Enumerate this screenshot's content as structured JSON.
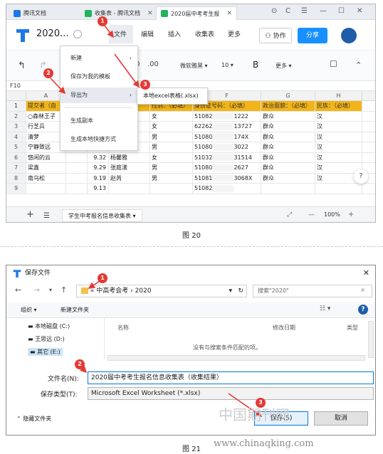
{
  "fig1": {
    "tabs": [
      {
        "label": "腾讯文档",
        "color": "#1d78e6"
      },
      {
        "label": "收集表 - 腾讯文档",
        "color": "#22b35e"
      },
      {
        "label": "2020届中考考生报",
        "color": "#22b35e"
      }
    ],
    "window_controls": [
      "⊙",
      "C",
      "☰",
      "—",
      "☐",
      "✕"
    ],
    "doc_title": "2020...",
    "menus": [
      "文件",
      "编辑",
      "插入",
      "收集表",
      "更多"
    ],
    "collab_label": "协作",
    "share_label": "分享",
    "toolbar": {
      "undo": "↰",
      "redo": "↱",
      "decimal_hint": ".0",
      "decimal_hint2": ".00",
      "font": "微软雅黑 ▾",
      "font_size": "10 ▾",
      "bold": "B",
      "more": "更多 ▾",
      "comment": "☐",
      "collapse": "⌃"
    },
    "cell_ref": "F10",
    "columns": [
      "",
      "A",
      "B",
      "C",
      "D",
      "E",
      "F",
      "G",
      "H"
    ],
    "header_row": [
      "提交者（自",
      "",
      "",
      "",
      "性别：（必填）",
      "身份证号码：（必填）",
      "政治面貌：（必填）",
      "民族：（必填）"
    ],
    "rows": [
      {
        "num": "2",
        "a": "○森林王子",
        "c": "",
        "d": "",
        "e": "女",
        "f": "51082",
        "f2": "1222",
        "g": "群众",
        "h": "汉"
      },
      {
        "num": "3",
        "a": "行芝兵",
        "c": "",
        "d": "",
        "e": "女",
        "f": "62262",
        "f2": "13727",
        "g": "群众",
        "h": "汉"
      },
      {
        "num": "4",
        "a": "清梦",
        "c": "",
        "d": "",
        "e": "男",
        "f": "51080",
        "f2": "174X",
        "g": "群众",
        "h": "汉"
      },
      {
        "num": "5",
        "a": "宁静致远",
        "c": "",
        "d": "",
        "e": "男",
        "f": "51080",
        "f2": "3022",
        "g": "群众",
        "h": "汉"
      },
      {
        "num": "6",
        "a": "悠闲的云",
        "c": "9.32",
        "d": "杨馨雅",
        "e": "女",
        "f": "51032",
        "f2": "31514",
        "g": "群众",
        "h": "汉"
      },
      {
        "num": "7",
        "a": "梁鑫",
        "c": "9.29",
        "d": "张庭漾",
        "e": "男",
        "f": "51080",
        "f2": "2627",
        "g": "群众",
        "h": "汉"
      },
      {
        "num": "8",
        "a": "南乌松",
        "c": "9.19",
        "d": "赵芮",
        "e": "男",
        "f": "51081",
        "f2": "3068X",
        "g": "群众",
        "h": "汉"
      },
      {
        "num": "9",
        "a": "",
        "c": "9.13",
        "d": "",
        "e": "",
        "f": "51082",
        "f2": "",
        "g": "",
        "h": ""
      }
    ],
    "sheet_tab": "学生中考报名信息收集表 ▾",
    "add_sheet": "+",
    "zoom": "100%",
    "zoom_minus": "—",
    "zoom_plus": "+",
    "help": "?",
    "dropdown": [
      {
        "label": "新建",
        "arrow": "›"
      },
      {
        "label": "保存为我的模板",
        "arrow": ""
      },
      {
        "label": "导出为",
        "arrow": "›"
      },
      {
        "label": "生成副本",
        "arrow": ""
      },
      {
        "label": "生成本地快捷方式",
        "arrow": ""
      }
    ],
    "submenu_item": "本地excel表格(.xlsx)",
    "badges": [
      "1",
      "2",
      "3"
    ]
  },
  "caption1": "图 20",
  "fig2": {
    "title": "保存文件",
    "close": "✕",
    "address_parts": [
      "«",
      "中高考会考",
      "›",
      "2020"
    ],
    "search_placeholder": "搜索\"2020\"",
    "organize": "组织 ▾",
    "new_folder": "新建文件夹",
    "drives": [
      {
        "label": "本地磁盘 (C:)"
      },
      {
        "label": "王思远 (D:)"
      },
      {
        "label": "其它 (E:)"
      }
    ],
    "col_name": "名称",
    "col_date": "修改日期",
    "col_type": "类型",
    "empty_text": "没有与搜索条件匹配的项。",
    "filename_label": "文件名(N):",
    "filename_value": "2020届中考考生报名信息收集表（收集结果）",
    "type_label": "保存类型(T):",
    "type_value": "Microsoft Excel Worksheet (*.xlsx)",
    "hide_folders": "隐藏文件夹",
    "save_label": "保存(S)",
    "cancel_label": "取消",
    "badges": [
      "1",
      "2",
      "3"
    ]
  },
  "caption2": "图 21",
  "watermark_cn": "中国期刊网",
  "watermark_url": "www.chinaqking.com",
  "colors": {
    "accent": "#1890ff",
    "header_row": "#f2b418",
    "badge": "#e53935"
  }
}
